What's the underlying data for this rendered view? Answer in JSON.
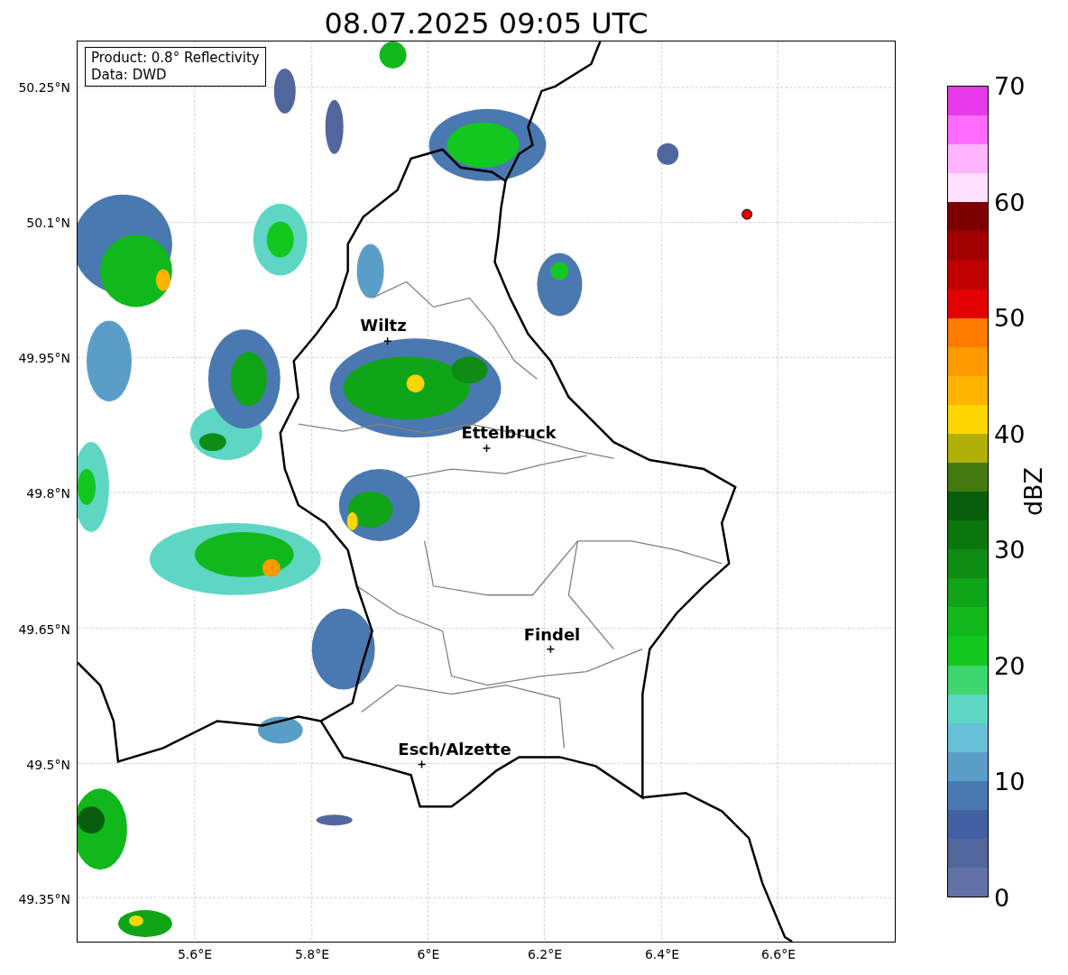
{
  "title": "08.07.2025 09:05 UTC",
  "info_box": [
    "Product: 0.8° Reflectivity",
    "Data: DWD"
  ],
  "y_ticks": [
    "50.25°N",
    "50.1°N",
    "49.95°N",
    "49.8°N",
    "49.65°N",
    "49.5°N",
    "49.35°N"
  ],
  "x_ticks": [
    "5.6°E",
    "5.8°E",
    "6°E",
    "6.2°E",
    "6.4°E",
    "6.6°E"
  ],
  "cities": [
    "Wiltz",
    "Ettelbruck",
    "Findel",
    "Esch/Alzette"
  ],
  "colorbar": {
    "label": "dBZ",
    "ticks": [
      "70",
      "60",
      "50",
      "40",
      "30",
      "20",
      "10",
      "0"
    ],
    "segments": [
      {
        "color": "#e83ae8"
      },
      {
        "color": "#ff6cff"
      },
      {
        "color": "#ffb4ff"
      },
      {
        "color": "#ffe0ff"
      },
      {
        "color": "#7c0000"
      },
      {
        "color": "#a00000"
      },
      {
        "color": "#c00000"
      },
      {
        "color": "#e20000"
      },
      {
        "color": "#ff7c00"
      },
      {
        "color": "#ff9a00"
      },
      {
        "color": "#ffb400"
      },
      {
        "color": "#ffd600"
      },
      {
        "color": "#b0b008"
      },
      {
        "color": "#447a10"
      },
      {
        "color": "#085e0c"
      },
      {
        "color": "#0b760e"
      },
      {
        "color": "#0e8c14"
      },
      {
        "color": "#10a418"
      },
      {
        "color": "#10b81c"
      },
      {
        "color": "#12c81e"
      },
      {
        "color": "#3ed670"
      },
      {
        "color": "#5fd6c4"
      },
      {
        "color": "#66c0d8"
      },
      {
        "color": "#5a9ec8"
      },
      {
        "color": "#4a78b0"
      },
      {
        "color": "#4460a4"
      },
      {
        "color": "#52669e"
      },
      {
        "color": "#6272a8"
      }
    ]
  }
}
